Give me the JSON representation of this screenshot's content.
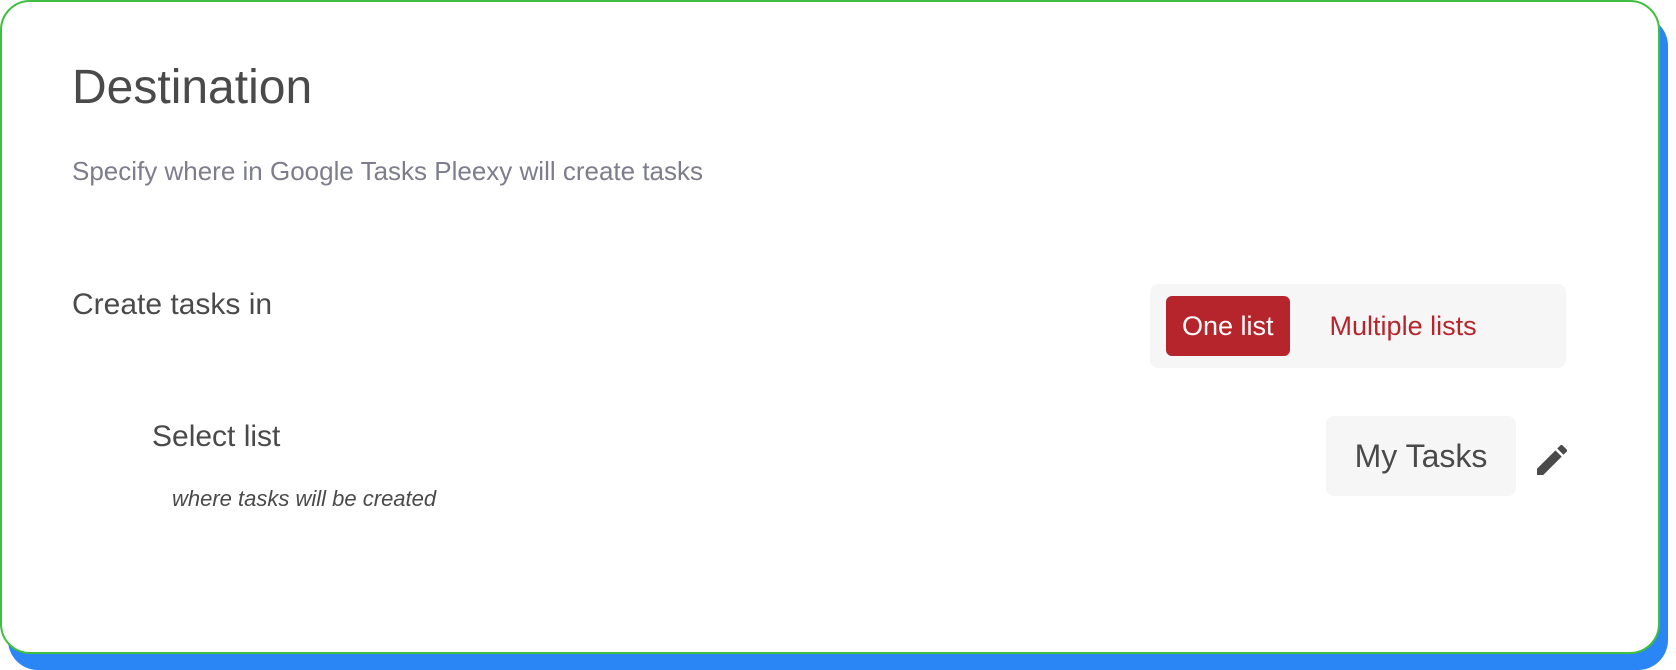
{
  "section": {
    "title": "Destination",
    "subtitle": "Specify where in Google Tasks Pleexy will create tasks"
  },
  "create_tasks": {
    "label": "Create tasks in",
    "options": [
      {
        "label": "One list",
        "selected": true
      },
      {
        "label": "Multiple lists",
        "selected": false
      }
    ]
  },
  "select_list": {
    "label": "Select list",
    "hint": "where tasks will be created",
    "value": "My Tasks",
    "edit_icon": "pencil-icon"
  },
  "colors": {
    "accent": "#b5252b",
    "card_border": "#3fbf3f",
    "card_shadow": "#2a86f4",
    "text": "#4a4a4a",
    "muted_text": "#7d7d8c"
  }
}
